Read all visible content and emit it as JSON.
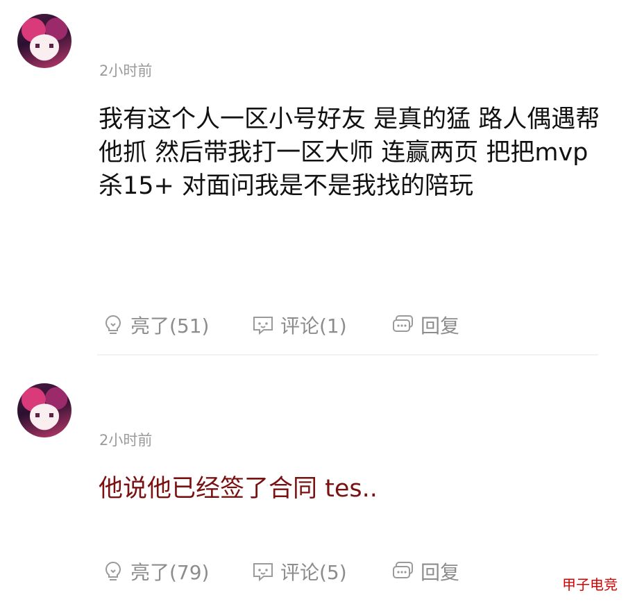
{
  "comments": [
    {
      "time": "2小时前",
      "text": "我有这个人一区小号好友 是真的猛 路人偶遇帮他抓 然后带我打一区大师 连赢两页 把把mvp杀15+ 对面问我是不是我找的陪玩",
      "actions": {
        "like": "亮了(51)",
        "comment": "评论(1)",
        "reply": "回复"
      }
    },
    {
      "time": "2小时前",
      "text": "他说他已经签了合同 tes..",
      "actions": {
        "like": "亮了(79)",
        "comment": "评论(5)",
        "reply": "回复"
      }
    }
  ],
  "watermark": "甲子电竞",
  "colors": {
    "highlight_text": "#7a1111",
    "muted": "#8c8c8c",
    "watermark": "#d60000"
  }
}
